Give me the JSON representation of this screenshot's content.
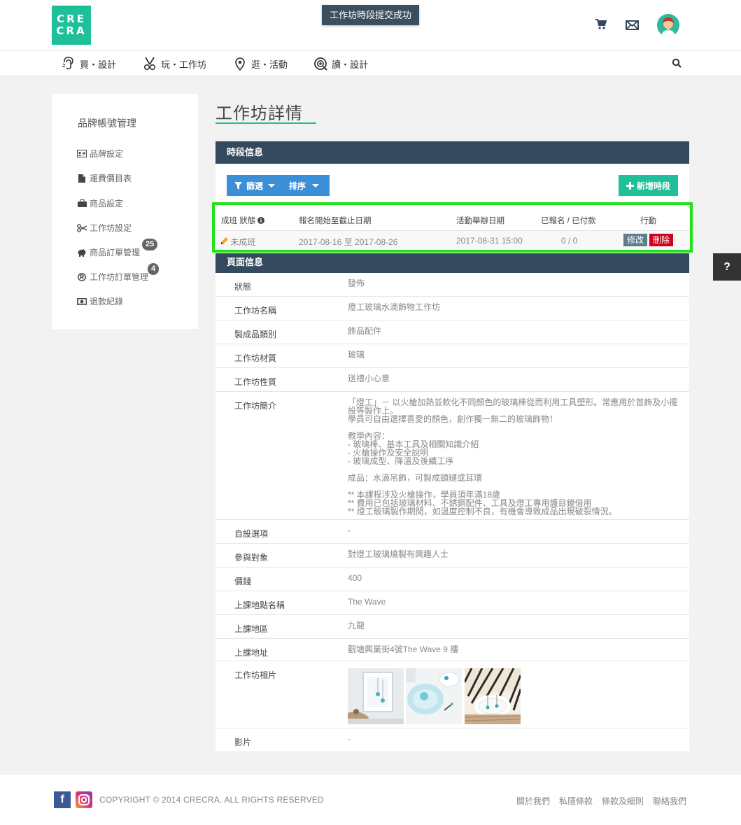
{
  "toast": "工作坊時段提交成功",
  "logo": {
    "line1": "CRE",
    "line2": "CRA"
  },
  "nav": [
    {
      "label": "買・設計",
      "icon": "ear-icon"
    },
    {
      "label": "玩・工作坊",
      "icon": "scissors-icon"
    },
    {
      "label": "逛・活動",
      "icon": "location-icon"
    },
    {
      "label": "讀・設計",
      "icon": "eye-icon"
    }
  ],
  "sidebar": {
    "title": "品牌帳號管理",
    "items": [
      {
        "label": "品牌設定",
        "icon": "id-card-icon"
      },
      {
        "label": "運費價目表",
        "icon": "document-icon"
      },
      {
        "label": "商品設定",
        "icon": "briefcase-icon"
      },
      {
        "label": "工作坊設定",
        "icon": "scissors-icon"
      },
      {
        "label": "商品訂單管理",
        "icon": "piggy-bank-icon",
        "badge": "25"
      },
      {
        "label": "工作坊訂單管理",
        "icon": "registered-icon",
        "badge": "4"
      },
      {
        "label": "退款紀錄",
        "icon": "money-icon"
      }
    ]
  },
  "page_title": "工作坊詳情",
  "schedule": {
    "heading": "時段信息",
    "filter_label": "篩選",
    "sort_label": "排序",
    "add_label": "新增時段",
    "columns": [
      "成班 狀態",
      "報名開始至截止日期",
      "活動舉辦日期",
      "已報名 / 已付款",
      "行動"
    ],
    "row": {
      "status": "未成班",
      "reg_period": "2017-08-16 至 2017-08-26",
      "event_date": "2017-08-31 15:00",
      "counts": "0 / 0",
      "edit_label": "修改",
      "delete_label": "刪除"
    }
  },
  "page_info": {
    "heading": "頁面信息",
    "rows": [
      {
        "label": "狀態",
        "value": "發佈"
      },
      {
        "label": "工作坊名稱",
        "value": "燈工玻璃水滴飾物工作坊"
      },
      {
        "label": "製成品類別",
        "value": "飾品配件"
      },
      {
        "label": "工作坊材質",
        "value": "玻璃"
      },
      {
        "label": "工作坊性質",
        "value": "送禮小心意"
      },
      {
        "label": "工作坊簡介",
        "value": "「燈工」－ 以火槍加熱並軟化不同顏色的玻璃棒從而利用工具塑形。常應用於首飾及小擺設等製作上。\n學員可自由選擇喜愛的顏色，創作獨一無二的玻璃飾物！\n\n教學內容：\n - 玻璃棒、基本工具及相關知識介紹\n - 火槍操作及安全說明\n - 玻璃成型、降溫及後續工序\n\n成品：水滴吊飾，可製成頸鏈或耳環\n\n** 本課程涉及火槍操作，學員須年滿18歲\n** 費用已包括玻璃材料、不銹鋼配件、工具及燈工專用護目鏡借用\n** 燈工玻璃製作期間，如溫度控制不良，有機會導致成品出現破裂情況。"
      },
      {
        "label": "自設選項",
        "value": "-"
      },
      {
        "label": "參與對象",
        "value": "對燈工玻璃燒製有興趣人士"
      },
      {
        "label": "價錢",
        "value": "400"
      },
      {
        "label": "上課地點名稱",
        "value": "The Wave"
      },
      {
        "label": "上課地區",
        "value": "九龍"
      },
      {
        "label": "上課地址",
        "value": "觀塘興業街4號The Wave 9 樓"
      },
      {
        "label": "工作坊相片",
        "value": ""
      },
      {
        "label": "影片",
        "value": "-"
      }
    ]
  },
  "help_label": "?",
  "footer": {
    "copyright": "COPYRIGHT © 2014 CRECRA. ALL RIGHTS RESERVED",
    "links": [
      "關於我們",
      "私隱條款",
      "條款及細則",
      "聯絡我們"
    ],
    "facebook_letter": "f"
  },
  "colors": {
    "accent": "#1fbf9a",
    "panel": "#34495e",
    "primary_btn": "#3b8fd6",
    "danger": "#d0021b",
    "highlight": "#22e01c"
  }
}
